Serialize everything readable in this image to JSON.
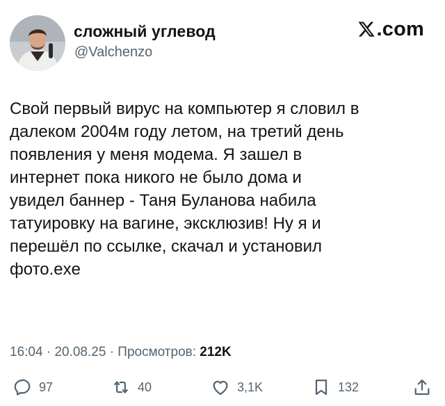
{
  "author": {
    "display_name": "сложный углевод",
    "handle": "@Valchenzo"
  },
  "brand": {
    "logo_text": ".com",
    "icon": "x-logo-icon"
  },
  "tweet": {
    "text": "Свой первый вирус на компьютер я словил в\nдалеком 2004м году летом, на третий день\nпоявления у меня модема. Я зашел в\nинтернет пока никого не было дома и\nувидел баннер - Таня Буланова набила\nтатуировку на вагине, эксклюзив! Ну я и\nперешёл по ссылке, скачал и установил\nфото.exe",
    "time": "16:04",
    "date": "20.08.25",
    "separator": "·",
    "views_label": "Просмотров:",
    "views_count": "212K"
  },
  "actions": {
    "replies": "97",
    "retweets": "40",
    "likes": "3,1K",
    "bookmarks": "132"
  },
  "colors": {
    "text": "#0f1419",
    "secondary": "#536471",
    "background": "#ffffff"
  }
}
